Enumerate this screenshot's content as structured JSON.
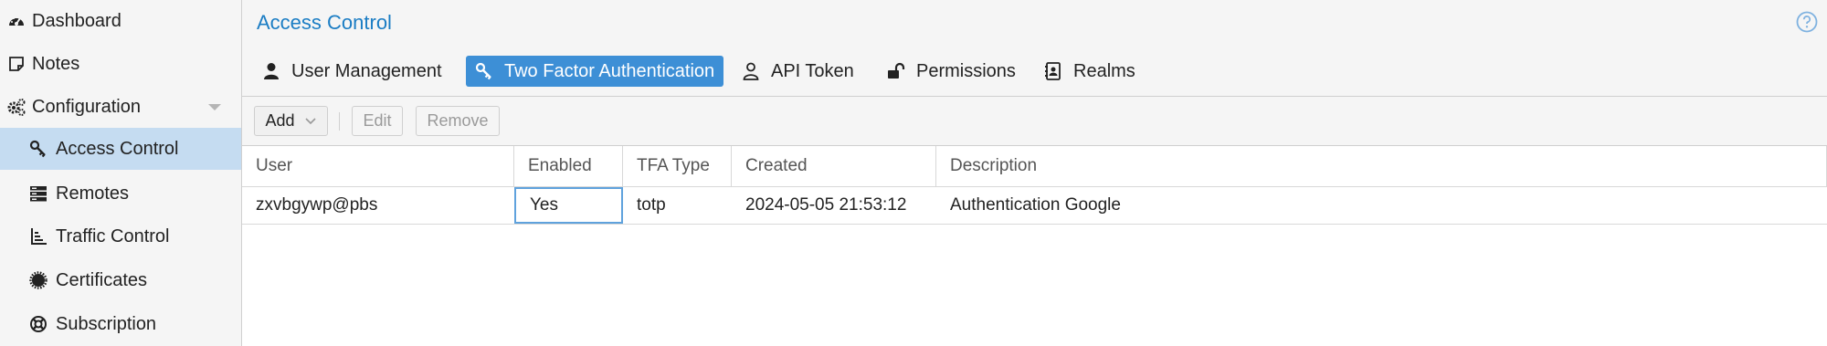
{
  "sidebar": {
    "items": [
      {
        "label": "Dashboard",
        "icon": "dashboard-icon"
      },
      {
        "label": "Notes",
        "icon": "note-icon"
      },
      {
        "label": "Configuration",
        "icon": "gears-icon"
      },
      {
        "label": "Access Control",
        "icon": "key-icon"
      },
      {
        "label": "Remotes",
        "icon": "server-icon"
      },
      {
        "label": "Traffic Control",
        "icon": "signal-icon"
      },
      {
        "label": "Certificates",
        "icon": "certificate-icon"
      },
      {
        "label": "Subscription",
        "icon": "support-icon"
      }
    ],
    "active": "Access Control"
  },
  "header": {
    "title": "Access Control",
    "help_icon": "question-circle-icon"
  },
  "tabs": [
    {
      "label": "User Management",
      "icon": "user-icon"
    },
    {
      "label": "Two Factor Authentication",
      "icon": "key-icon"
    },
    {
      "label": "API Token",
      "icon": "user-outline-icon"
    },
    {
      "label": "Permissions",
      "icon": "unlock-icon"
    },
    {
      "label": "Realms",
      "icon": "address-book-icon"
    }
  ],
  "active_tab": "Two Factor Authentication",
  "toolbar": {
    "add_label": "Add",
    "edit_label": "Edit",
    "remove_label": "Remove"
  },
  "table": {
    "columns": [
      "User",
      "Enabled",
      "TFA Type",
      "Created",
      "Description"
    ],
    "rows": [
      [
        "zxvbgywp@pbs",
        "Yes",
        "totp",
        "2024-05-05 21:53:12",
        "Authentication Google"
      ]
    ]
  },
  "colors": {
    "accent": "#3d8fd6",
    "title": "#1b7dc4",
    "selected_nav": "#c5dcf1"
  }
}
